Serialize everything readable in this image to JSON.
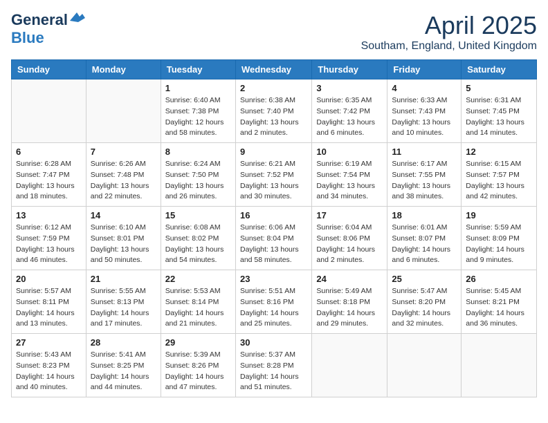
{
  "header": {
    "logo": {
      "general": "General",
      "blue": "Blue"
    },
    "title": "April 2025",
    "subtitle": "Southam, England, United Kingdom"
  },
  "weekdays": [
    "Sunday",
    "Monday",
    "Tuesday",
    "Wednesday",
    "Thursday",
    "Friday",
    "Saturday"
  ],
  "weeks": [
    [
      {
        "day": "",
        "info": ""
      },
      {
        "day": "",
        "info": ""
      },
      {
        "day": "1",
        "info": "Sunrise: 6:40 AM\nSunset: 7:38 PM\nDaylight: 12 hours and 58 minutes."
      },
      {
        "day": "2",
        "info": "Sunrise: 6:38 AM\nSunset: 7:40 PM\nDaylight: 13 hours and 2 minutes."
      },
      {
        "day": "3",
        "info": "Sunrise: 6:35 AM\nSunset: 7:42 PM\nDaylight: 13 hours and 6 minutes."
      },
      {
        "day": "4",
        "info": "Sunrise: 6:33 AM\nSunset: 7:43 PM\nDaylight: 13 hours and 10 minutes."
      },
      {
        "day": "5",
        "info": "Sunrise: 6:31 AM\nSunset: 7:45 PM\nDaylight: 13 hours and 14 minutes."
      }
    ],
    [
      {
        "day": "6",
        "info": "Sunrise: 6:28 AM\nSunset: 7:47 PM\nDaylight: 13 hours and 18 minutes."
      },
      {
        "day": "7",
        "info": "Sunrise: 6:26 AM\nSunset: 7:48 PM\nDaylight: 13 hours and 22 minutes."
      },
      {
        "day": "8",
        "info": "Sunrise: 6:24 AM\nSunset: 7:50 PM\nDaylight: 13 hours and 26 minutes."
      },
      {
        "day": "9",
        "info": "Sunrise: 6:21 AM\nSunset: 7:52 PM\nDaylight: 13 hours and 30 minutes."
      },
      {
        "day": "10",
        "info": "Sunrise: 6:19 AM\nSunset: 7:54 PM\nDaylight: 13 hours and 34 minutes."
      },
      {
        "day": "11",
        "info": "Sunrise: 6:17 AM\nSunset: 7:55 PM\nDaylight: 13 hours and 38 minutes."
      },
      {
        "day": "12",
        "info": "Sunrise: 6:15 AM\nSunset: 7:57 PM\nDaylight: 13 hours and 42 minutes."
      }
    ],
    [
      {
        "day": "13",
        "info": "Sunrise: 6:12 AM\nSunset: 7:59 PM\nDaylight: 13 hours and 46 minutes."
      },
      {
        "day": "14",
        "info": "Sunrise: 6:10 AM\nSunset: 8:01 PM\nDaylight: 13 hours and 50 minutes."
      },
      {
        "day": "15",
        "info": "Sunrise: 6:08 AM\nSunset: 8:02 PM\nDaylight: 13 hours and 54 minutes."
      },
      {
        "day": "16",
        "info": "Sunrise: 6:06 AM\nSunset: 8:04 PM\nDaylight: 13 hours and 58 minutes."
      },
      {
        "day": "17",
        "info": "Sunrise: 6:04 AM\nSunset: 8:06 PM\nDaylight: 14 hours and 2 minutes."
      },
      {
        "day": "18",
        "info": "Sunrise: 6:01 AM\nSunset: 8:07 PM\nDaylight: 14 hours and 6 minutes."
      },
      {
        "day": "19",
        "info": "Sunrise: 5:59 AM\nSunset: 8:09 PM\nDaylight: 14 hours and 9 minutes."
      }
    ],
    [
      {
        "day": "20",
        "info": "Sunrise: 5:57 AM\nSunset: 8:11 PM\nDaylight: 14 hours and 13 minutes."
      },
      {
        "day": "21",
        "info": "Sunrise: 5:55 AM\nSunset: 8:13 PM\nDaylight: 14 hours and 17 minutes."
      },
      {
        "day": "22",
        "info": "Sunrise: 5:53 AM\nSunset: 8:14 PM\nDaylight: 14 hours and 21 minutes."
      },
      {
        "day": "23",
        "info": "Sunrise: 5:51 AM\nSunset: 8:16 PM\nDaylight: 14 hours and 25 minutes."
      },
      {
        "day": "24",
        "info": "Sunrise: 5:49 AM\nSunset: 8:18 PM\nDaylight: 14 hours and 29 minutes."
      },
      {
        "day": "25",
        "info": "Sunrise: 5:47 AM\nSunset: 8:20 PM\nDaylight: 14 hours and 32 minutes."
      },
      {
        "day": "26",
        "info": "Sunrise: 5:45 AM\nSunset: 8:21 PM\nDaylight: 14 hours and 36 minutes."
      }
    ],
    [
      {
        "day": "27",
        "info": "Sunrise: 5:43 AM\nSunset: 8:23 PM\nDaylight: 14 hours and 40 minutes."
      },
      {
        "day": "28",
        "info": "Sunrise: 5:41 AM\nSunset: 8:25 PM\nDaylight: 14 hours and 44 minutes."
      },
      {
        "day": "29",
        "info": "Sunrise: 5:39 AM\nSunset: 8:26 PM\nDaylight: 14 hours and 47 minutes."
      },
      {
        "day": "30",
        "info": "Sunrise: 5:37 AM\nSunset: 8:28 PM\nDaylight: 14 hours and 51 minutes."
      },
      {
        "day": "",
        "info": ""
      },
      {
        "day": "",
        "info": ""
      },
      {
        "day": "",
        "info": ""
      }
    ]
  ]
}
